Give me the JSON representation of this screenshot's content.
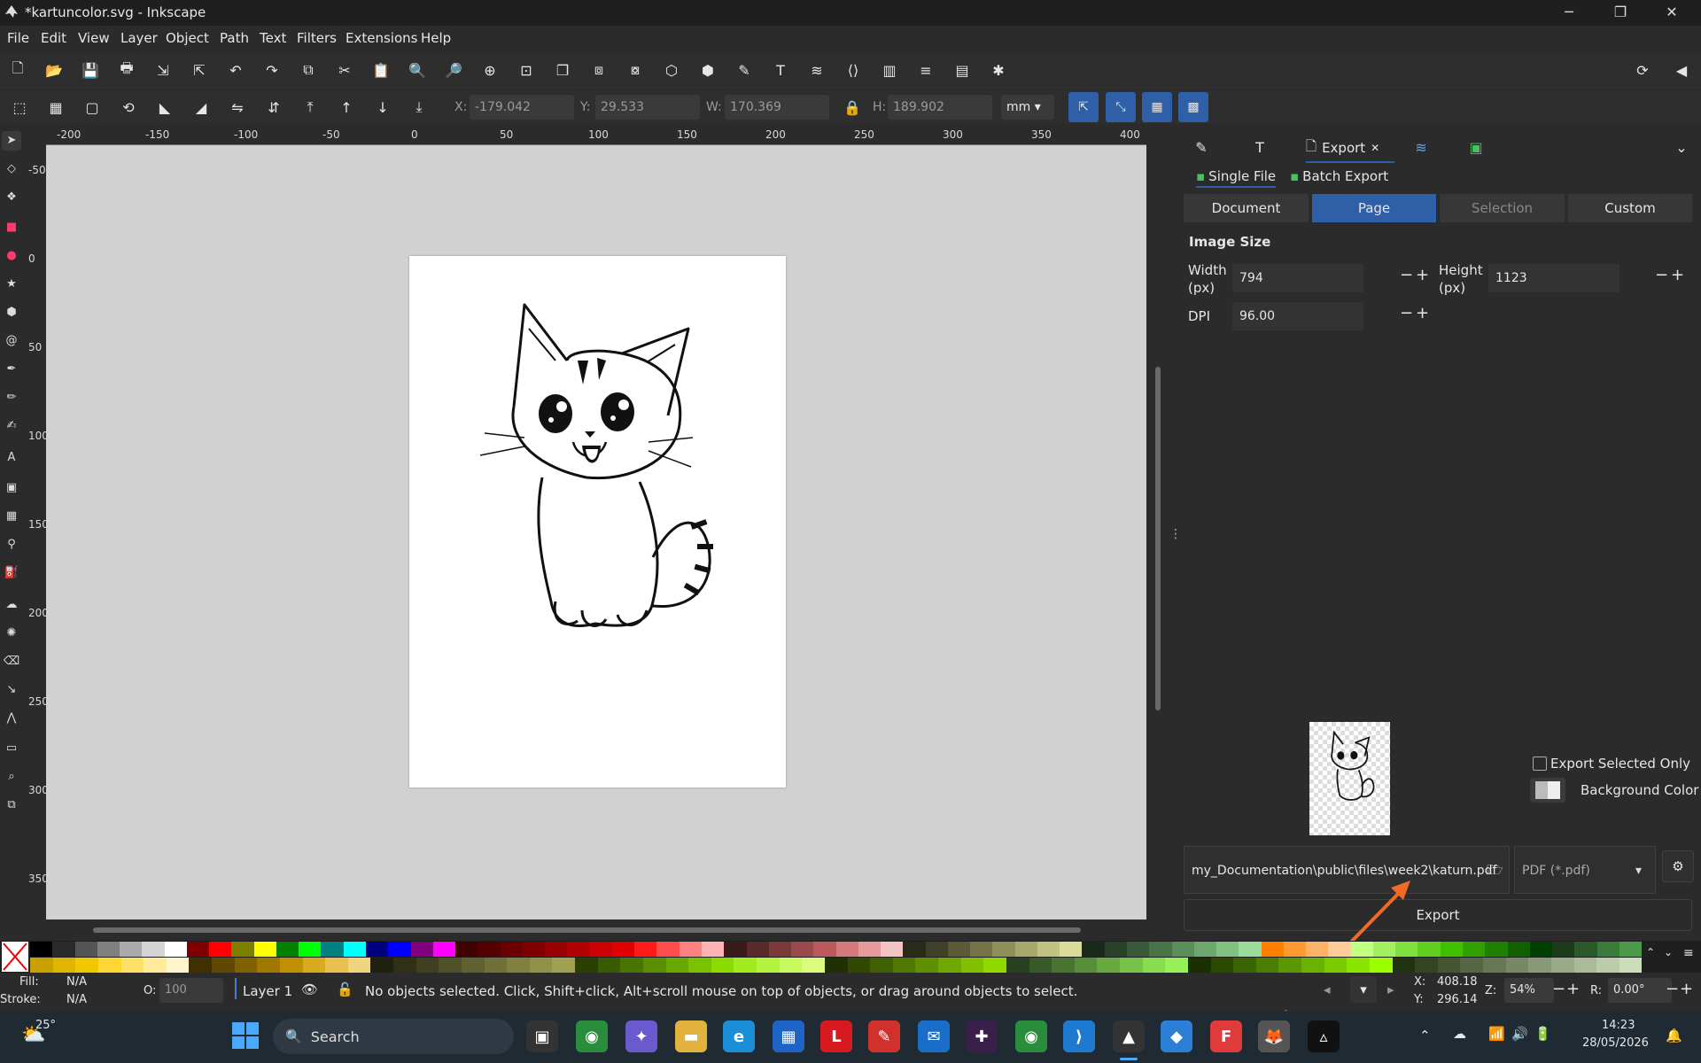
{
  "window": {
    "title": "*kartuncolor.svg - Inkscape",
    "minimize": "─",
    "maximize": "❐",
    "close": "✕"
  },
  "menu": [
    "File",
    "Edit",
    "View",
    "Layer",
    "Object",
    "Path",
    "Text",
    "Filters",
    "Extensions",
    "Help"
  ],
  "toolbar2": {
    "x_label": "X:",
    "x_value": "-179.042",
    "y_label": "Y:",
    "y_value": "29.533",
    "w_label": "W:",
    "w_value": "170.369",
    "h_label": "H:",
    "h_value": "189.902",
    "unit": "mm"
  },
  "ruler_h": [
    "-200",
    "-150",
    "-100",
    "-50",
    "0",
    "50",
    "100",
    "150",
    "200",
    "250",
    "300",
    "350",
    "400"
  ],
  "ruler_v": [
    "-50",
    "0",
    "50",
    "100",
    "150",
    "200",
    "250",
    "300",
    "350"
  ],
  "panel": {
    "tab_export": "Export",
    "mode_single": "Single File",
    "mode_batch": "Batch Export",
    "areas": [
      "Document",
      "Page",
      "Selection",
      "Custom"
    ],
    "selected_area": "Page",
    "image_size_title": "Image Size",
    "width_label": "Width",
    "width_unit": "(px)",
    "width_value": "794",
    "height_label": "Height",
    "height_unit": "(px)",
    "height_value": "1123",
    "dpi_label": "DPI",
    "dpi_value": "96.00",
    "export_selected_only": "Export Selected Only",
    "background_color": "Background Color",
    "filename": "my_Documentation\\public\\files\\week2\\katurn.pdf",
    "format": "PDF (*.pdf)",
    "export_button": "Export"
  },
  "status": {
    "fill_label": "Fill:",
    "fill_value": "N/A",
    "stroke_label": "Stroke:",
    "stroke_value": "N/A",
    "opacity_label": "O:",
    "opacity_value": "100",
    "layer": "Layer 1",
    "message": "No objects selected. Click, Shift+click, Alt+scroll mouse on top of objects, or drag around objects to select.",
    "x_label": "X:",
    "x_value": "408.18",
    "y_label": "Y:",
    "y_value": "296.14",
    "zoom_label": "Z:",
    "zoom_value": "54%",
    "rotation_label": "R:",
    "rotation_value": "0.00°"
  },
  "taskbar": {
    "weather_temp": "25°",
    "search_placeholder": "Search",
    "time": "14:23",
    "date": "28/05/2026"
  },
  "colors": {
    "accent": "#2f5fa6",
    "arrow": "#f06a24"
  },
  "palette_top": [
    "#000000",
    "#2a2a2a",
    "#555555",
    "#808080",
    "#aaaaaa",
    "#d4d4d4",
    "#ffffff",
    "#800000",
    "#ff0000",
    "#808000",
    "#ffff00",
    "#008000",
    "#00ff00",
    "#008080",
    "#00ffff",
    "#000080",
    "#0000ff",
    "#800080",
    "#ff00ff",
    "#400000",
    "#550000",
    "#6b0000",
    "#800000",
    "#990000",
    "#b00000",
    "#cc0000",
    "#e00000",
    "#ff1a1a",
    "#ff4d4d",
    "#ff8080",
    "#ffb3b3",
    "#3a1a1a",
    "#5a2a2a",
    "#7a3a3a",
    "#9a4a4a",
    "#bb5a5a",
    "#d47a7a",
    "#e89a9a",
    "#f4c4c4",
    "#2a2a1a",
    "#404028",
    "#5a5a38",
    "#747448",
    "#8e8e5a",
    "#a8a86c",
    "#c2c280",
    "#dcdc9a",
    "#1a2a1a",
    "#284028",
    "#385a38",
    "#487448",
    "#5a8e5a",
    "#6ca86c",
    "#80c280",
    "#9adc9a",
    "#ff8000",
    "#ff9a33",
    "#ffb366",
    "#ffcc99",
    "#c0ff80",
    "#a0f060",
    "#80e040",
    "#60d020",
    "#40c000",
    "#30a000",
    "#208000",
    "#106000",
    "#004000",
    "#1a3a1a",
    "#2a5a2a",
    "#3a7a3a",
    "#4a9a4a"
  ],
  "palette_bottom": [
    "#c8a000",
    "#e0b400",
    "#f0c800",
    "#ffd633",
    "#ffe066",
    "#ffeb99",
    "#fff5cc",
    "#403000",
    "#604800",
    "#806000",
    "#a07800",
    "#c09000",
    "#d8aa20",
    "#e8c050",
    "#f0d480",
    "#202010",
    "#303018",
    "#404020",
    "#505028",
    "#606030",
    "#707038",
    "#808040",
    "#909048",
    "#a0a050",
    "#2a4000",
    "#3a5a00",
    "#4a7400",
    "#5a8e00",
    "#6aa800",
    "#7ac200",
    "#8adc00",
    "#a0ec20",
    "#b4f440",
    "#c8fa60",
    "#dcfc80",
    "#203000",
    "#304800",
    "#406000",
    "#507800",
    "#609000",
    "#70a800",
    "#80c000",
    "#90d800",
    "#284020",
    "#385a28",
    "#487430",
    "#588e38",
    "#68a840",
    "#78c248",
    "#88dc50",
    "#98f058",
    "#1a3000",
    "#2a4a00",
    "#3a6400",
    "#4a7e00",
    "#5a9800",
    "#6ab200",
    "#7acc00",
    "#8ae600",
    "#9aff00",
    "#223311",
    "#334422",
    "#445533",
    "#556644",
    "#667755",
    "#778866",
    "#889977",
    "#99aa88",
    "#aabb99",
    "#bbccaa",
    "#ccddbb"
  ]
}
